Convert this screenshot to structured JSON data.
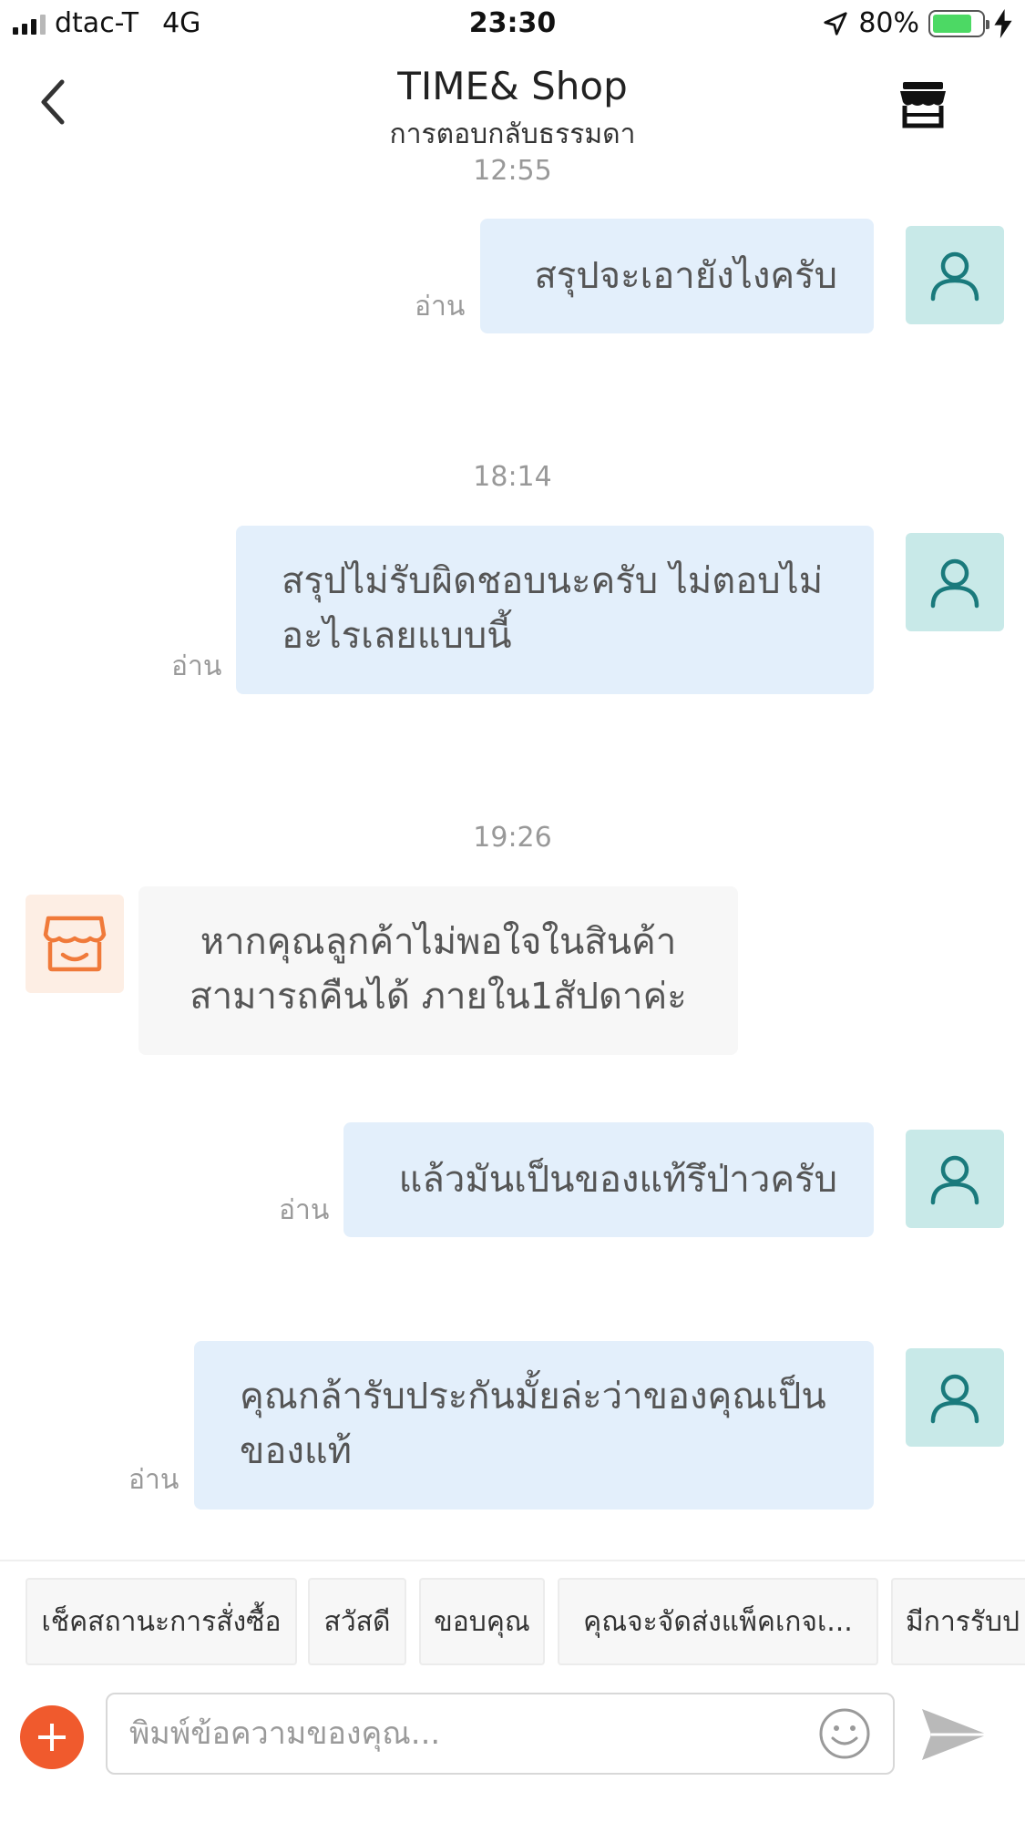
{
  "status_bar": {
    "carrier": "dtac-T",
    "network": "4G",
    "time": "23:30",
    "battery_percent": "80%",
    "battery_level": 0.8,
    "icons": [
      "signal-icon",
      "location-arrow-icon",
      "battery-icon",
      "charging-bolt-icon"
    ]
  },
  "header": {
    "title": "TIME& Shop",
    "subtitle": "การตอบกลับธรรมดา",
    "back_icon": "chevron-left-icon",
    "shop_icon": "storefront-icon"
  },
  "chat": {
    "timestamps": [
      "12:55",
      "18:14",
      "19:26"
    ],
    "messages": [
      {
        "direction": "outgoing",
        "text": "สรุปจะเอายังไงครับ",
        "status": "อ่าน"
      },
      {
        "direction": "outgoing",
        "text": "สรุปไม่รับผิดชอบนะครับ ไม่ตอบไม่อะไรเลยแบบนี้",
        "status": "อ่าน"
      },
      {
        "direction": "incoming",
        "text": "หากคุณลูกค้าไม่พอใจในสินค้า สามารถคืนได้ ภายใน1สัปดาค่ะ"
      },
      {
        "direction": "outgoing",
        "text": "แล้วมันเป็นของแท้รึป่าวครับ",
        "status": "อ่าน"
      },
      {
        "direction": "outgoing",
        "text": "คุณกล้ารับประกันมั้ยล่ะว่าของคุณเป็นของแท้",
        "status": "อ่าน"
      }
    ]
  },
  "quick_replies": [
    "เช็คสถานะการสั่งซื้อ",
    "สวัสดี",
    "ขอบคุณ",
    "คุณจะจัดส่งแพ็คเกจเ...",
    "มีการรับป"
  ],
  "composer": {
    "placeholder": "พิมพ์ข้อความของคุณ...",
    "value": "",
    "add_icon": "plus-icon",
    "emoji_icon": "smiley-icon",
    "send_icon": "send-icon"
  },
  "colors": {
    "outgoing_bubble": "#e3effb",
    "incoming_bubble": "#f7f7f7",
    "user_avatar_bg": "#c8e9e8",
    "user_avatar_icon": "#1a7a7c",
    "shop_avatar_bg": "#fdeee4",
    "shop_avatar_icon": "#f07a3a",
    "accent": "#f05a2d"
  }
}
